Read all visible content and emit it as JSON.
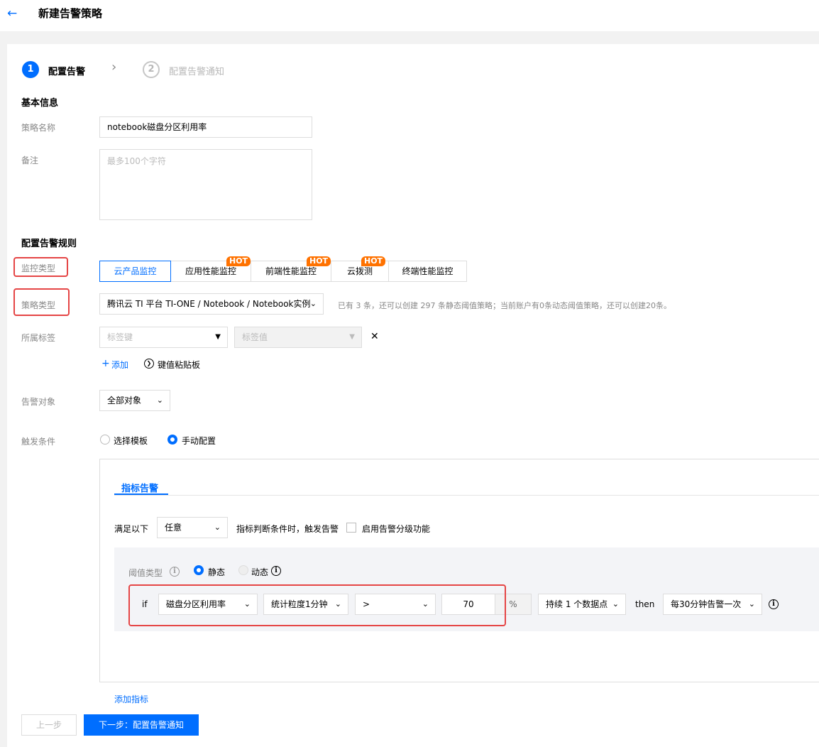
{
  "header": {
    "back_icon": "arrow-left-icon",
    "title": "新建告警策略"
  },
  "steps": [
    {
      "num": "1",
      "label": "配置告警"
    },
    {
      "num": "2",
      "label": "配置告警通知"
    }
  ],
  "basic": {
    "title": "基本信息",
    "name_label": "策略名称",
    "name_value": "notebook磁盘分区利用率",
    "remark_label": "备注",
    "remark_placeholder": "最多100个字符"
  },
  "rules": {
    "title": "配置告警规则",
    "monitor_type_label": "监控类型",
    "monitor_tabs": [
      {
        "label": "云产品监控",
        "hot": false
      },
      {
        "label": "应用性能监控",
        "hot": true
      },
      {
        "label": "前端性能监控",
        "hot": true
      },
      {
        "label": "云拨测",
        "hot": true
      },
      {
        "label": "终端性能监控",
        "hot": false
      }
    ],
    "hot_badge": "HOT",
    "policy_type_label": "策略类型",
    "policy_type_value": "腾讯云 TI 平台 TI-ONE / Notebook / Notebook实例",
    "policy_hint": "已有 3 条，还可以创建 297 条静态阈值策略；当前账户有0条动态阈值策略，还可以创建20条。",
    "tags_label": "所属标签",
    "tag_key_placeholder": "标签键",
    "tag_value_placeholder": "标签值",
    "add_label": "添加",
    "paste_label": "键值粘贴板",
    "target_label": "告警对象",
    "target_value": "全部对象",
    "trigger_label": "触发条件",
    "trigger_options": [
      "选择模板",
      "手动配置"
    ]
  },
  "metric": {
    "tab_label": "指标告警",
    "satisfy_prefix": "满足以下",
    "satisfy_value": "任意",
    "satisfy_suffix": "指标判断条件时，触发告警",
    "tiered_label": "启用告警分级功能",
    "threshold_label": "阈值类型",
    "threshold_static": "静态",
    "threshold_dynamic": "动态",
    "if_label": "if",
    "metric_value": "磁盘分区利用率",
    "granularity_value": "统计粒度1分钟",
    "operator_value": ">",
    "threshold_value": "70",
    "unit": "%",
    "duration_value": "持续 1 个数据点",
    "then_label": "then",
    "frequency_value": "每30分钟告警一次",
    "add_metric": "添加指标"
  },
  "footer": {
    "prev_label": "上一步",
    "next_label": "下一步：配置告警通知"
  }
}
